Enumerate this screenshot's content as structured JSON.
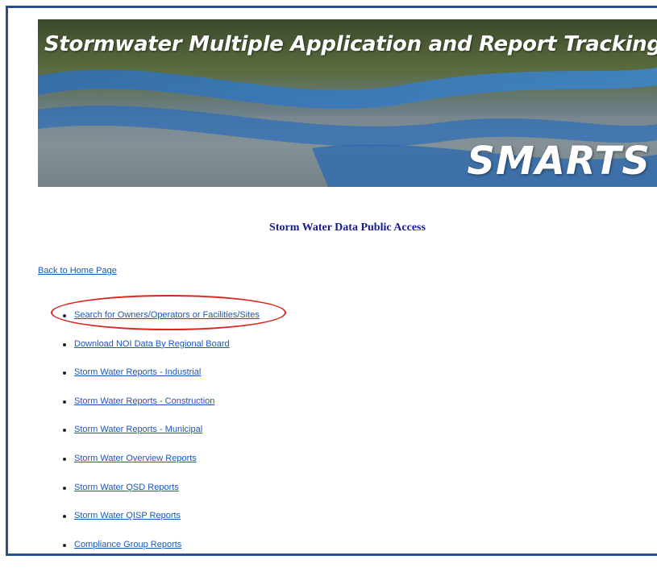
{
  "banner": {
    "title": "Stormwater Multiple Application and Report Tracking System",
    "logo_text": "SMARTS"
  },
  "page": {
    "heading": "Storm Water Data Public Access",
    "back_link": "Back to Home Page"
  },
  "links": [
    "Search for Owners/Operators or Facilities/Sites",
    "Download NOI Data By Regional Board",
    "Storm Water Reports - Industrial",
    "Storm Water Reports - Construction",
    "Storm Water Reports - Municipal",
    "Storm Water Overview Reports",
    "Storm Water QSD Reports",
    "Storm Water QISP Reports",
    "Compliance Group Reports"
  ],
  "colors": {
    "frame_border": "#2a4f8f",
    "link": "#1a57b8",
    "heading": "#1a1a8c",
    "highlight": "#d8261f"
  }
}
